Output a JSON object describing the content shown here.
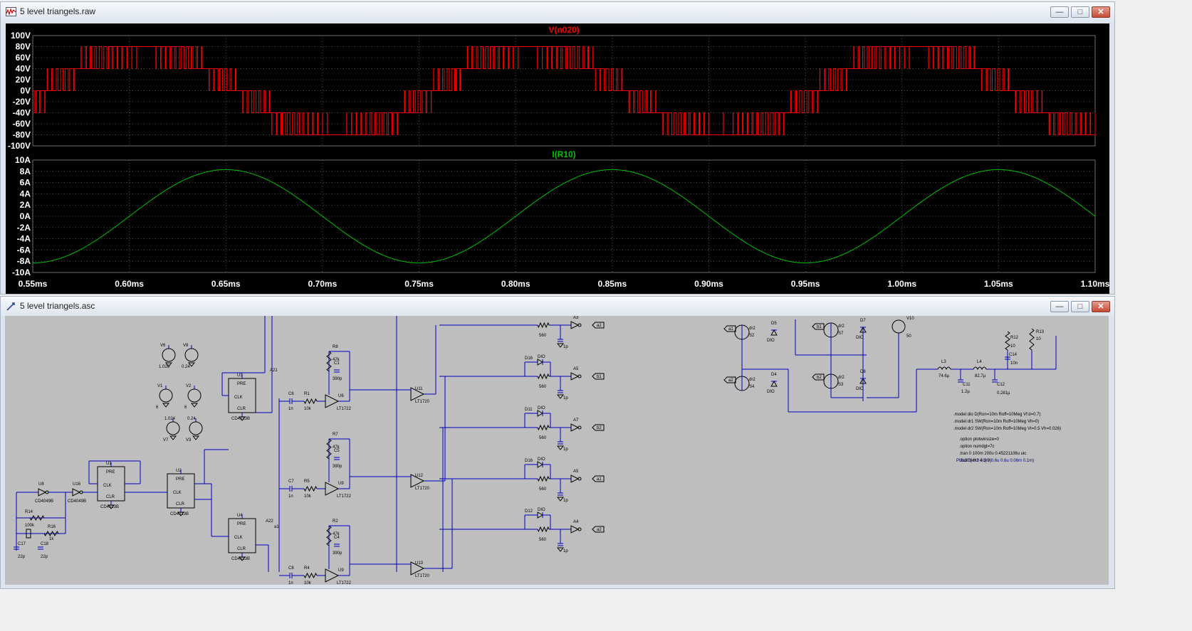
{
  "waveform_window": {
    "title": "5 level triangels.raw",
    "buttons": {
      "minimize": "—",
      "maximize": "□",
      "close": "✕"
    }
  },
  "schematic_window": {
    "title": "5 level triangels.asc",
    "buttons": {
      "minimize": "—",
      "maximize": "□",
      "close": "✕"
    }
  },
  "colors": {
    "background": "#000000",
    "grid": "#555555",
    "trace_v": "#ff0000",
    "trace_i": "#00c000",
    "schematic_bg": "#bebebe",
    "wire": "#0000c0"
  },
  "chart_data": [
    {
      "type": "line",
      "title": "V(n020)",
      "ylim": [
        -100,
        100
      ],
      "yticks": [
        "100V",
        "80V",
        "60V",
        "40V",
        "20V",
        "0V",
        "-20V",
        "-40V",
        "-60V",
        "-80V",
        "-100V"
      ],
      "grid": true,
      "x_range_ms": [
        0.55,
        1.1
      ],
      "period_ms": 0.2,
      "levels": [
        -80,
        -40,
        0,
        40,
        80
      ],
      "series": [
        {
          "name": "V(n020)",
          "color": "#ff0000"
        }
      ]
    },
    {
      "type": "line",
      "title": "I(R10)",
      "ylim": [
        -10,
        10
      ],
      "yticks": [
        "10A",
        "8A",
        "6A",
        "4A",
        "2A",
        "0A",
        "-2A",
        "-4A",
        "-6A",
        "-8A",
        "-10A"
      ],
      "grid": true,
      "x_range_ms": [
        0.55,
        1.1
      ],
      "amplitude": 8.3,
      "period_ms": 0.2,
      "peak_ms": 0.65,
      "series": [
        {
          "name": "I(R10)",
          "color": "#00c000"
        }
      ]
    }
  ],
  "xticks": [
    "0.55ms",
    "0.60ms",
    "0.65ms",
    "0.70ms",
    "0.75ms",
    "0.80ms",
    "0.85ms",
    "0.90ms",
    "0.95ms",
    "1.00ms",
    "1.05ms",
    "1.10ms"
  ],
  "schematic": {
    "labels": [
      {
        "t": "V6",
        "k": "a"
      },
      {
        "t": "V8",
        "k": "b"
      },
      {
        "t": "1.026",
        "k": "c"
      },
      {
        "t": "0.24",
        "k": "d"
      },
      {
        "t": "V1",
        "k": "e"
      },
      {
        "t": "V2",
        "k": "f"
      },
      {
        "t": "6",
        "k": "g"
      },
      {
        "t": "6",
        "k": "h"
      },
      {
        "t": "1.024",
        "k": "i"
      },
      {
        "t": "0.24",
        "k": "j"
      },
      {
        "t": "V7",
        "k": "k"
      },
      {
        "t": "V3",
        "k": "l"
      },
      {
        "t": "U1",
        "k": "m"
      },
      {
        "t": "U2",
        "k": "n"
      },
      {
        "t": "U3",
        "k": "o"
      },
      {
        "t": "U4",
        "k": "p"
      },
      {
        "t": "PRE",
        "k": "q"
      },
      {
        "t": "CLR",
        "k": "r"
      },
      {
        "t": "CLK",
        "k": "s"
      },
      {
        "t": "CD4013B",
        "k": "t"
      },
      {
        "t": "CD4049B",
        "k": "u"
      },
      {
        "t": "U8",
        "k": "v"
      },
      {
        "t": "U16",
        "k": "w"
      },
      {
        "t": "R14",
        "k": "x"
      },
      {
        "t": "100k",
        "k": "y"
      },
      {
        "t": "R16",
        "k": "z"
      },
      {
        "t": "1k",
        "k": "aa"
      },
      {
        "t": "C17",
        "k": "ab"
      },
      {
        "t": "C18",
        "k": "ac"
      },
      {
        "t": "22p",
        "k": "ad"
      },
      {
        "t": "R1",
        "k": "ae"
      },
      {
        "t": "R5",
        "k": "af"
      },
      {
        "t": "R4",
        "k": "ag"
      },
      {
        "t": "10k",
        "k": "ah"
      },
      {
        "t": "C6",
        "k": "ai"
      },
      {
        "t": "C7",
        "k": "aj"
      },
      {
        "t": "C8",
        "k": "ak"
      },
      {
        "t": "1n",
        "k": "al"
      },
      {
        "t": "R8",
        "k": "am"
      },
      {
        "t": "R7",
        "k": "an"
      },
      {
        "t": "R2",
        "k": "ao"
      },
      {
        "t": "47k",
        "k": "ap"
      },
      {
        "t": "C1",
        "k": "aq"
      },
      {
        "t": "C5",
        "k": "ar"
      },
      {
        "t": "C4",
        "k": "as"
      },
      {
        "t": "390p",
        "k": "at"
      },
      {
        "t": "U6",
        "k": "au"
      },
      {
        "t": "U9",
        "k": "av"
      },
      {
        "t": "LT1722",
        "k": "aw"
      },
      {
        "t": "U11",
        "k": "ax"
      },
      {
        "t": "U12",
        "k": "ay"
      },
      {
        "t": "U13",
        "k": "az"
      },
      {
        "t": "LT1720",
        "k": "ba"
      },
      {
        "t": "D16",
        "k": "bb"
      },
      {
        "t": "D11",
        "k": "bc"
      },
      {
        "t": "D12",
        "k": "bd"
      },
      {
        "t": "DIO",
        "k": "be"
      },
      {
        "t": "560",
        "k": "bf"
      },
      {
        "t": "1p",
        "k": "bg"
      },
      {
        "t": "A3",
        "k": "bh"
      },
      {
        "t": "A5",
        "k": "bi"
      },
      {
        "t": "A7",
        "k": "bj"
      },
      {
        "t": "A4",
        "k": "bk"
      },
      {
        "t": "a2",
        "k": "bl"
      },
      {
        "t": "b1",
        "k": "bm"
      },
      {
        "t": "b2",
        "k": "bn"
      },
      {
        "t": "a1",
        "k": "bo"
      },
      {
        "t": "A21",
        "k": "bp"
      },
      {
        "t": "A22",
        "k": "bq"
      },
      {
        "t": "D5",
        "k": "br"
      },
      {
        "t": "D4",
        "k": "bs"
      },
      {
        "t": "D7",
        "k": "bt"
      },
      {
        "t": "D8",
        "k": "bu"
      },
      {
        "t": "S2",
        "k": "bv"
      },
      {
        "t": "S4",
        "k": "bw"
      },
      {
        "t": "S7",
        "k": "bx"
      },
      {
        "t": "S3",
        "k": "by"
      },
      {
        "t": "dr2",
        "k": "bz"
      },
      {
        "t": "V10",
        "k": "ca"
      },
      {
        "t": "50",
        "k": "cb"
      },
      {
        "t": "L3",
        "k": "cc"
      },
      {
        "t": "74.6µ",
        "k": "cd"
      },
      {
        "t": "L4",
        "k": "ce"
      },
      {
        "t": "82.7µ",
        "k": "cf"
      },
      {
        "t": "C11",
        "k": "cg"
      },
      {
        "t": "1.2µ",
        "k": "ch"
      },
      {
        "t": "C12",
        "k": "ci"
      },
      {
        "t": "0.281µ",
        "k": "cj"
      },
      {
        "t": "R12",
        "k": "ck"
      },
      {
        "t": "R13",
        "k": "cl"
      },
      {
        "t": "10",
        "k": "cm"
      },
      {
        "t": "C14",
        "k": "cn"
      },
      {
        "t": "10n",
        "k": "co"
      }
    ],
    "directives": [
      ".model dio D(Ron=10m Roff=10Meg Vf:d=0.7)",
      ".model dr1 SW(Ron=10m Roff=10Meg Vh=0)",
      ".model dr2 SW(Ron=10m Roff=10Meg Vt=0.5 Vh=0.026)",
      ".option plotwinsize=0",
      ".option numdgt=7c",
      ".tran 0 100m 200u 0.45221108u uic",
      ".four 1kHz 4 I(r9)"
    ],
    "pulse": "PULSE(-0.3 0.3 0 0.6u 0.6u 0.06m 0.1m)"
  }
}
